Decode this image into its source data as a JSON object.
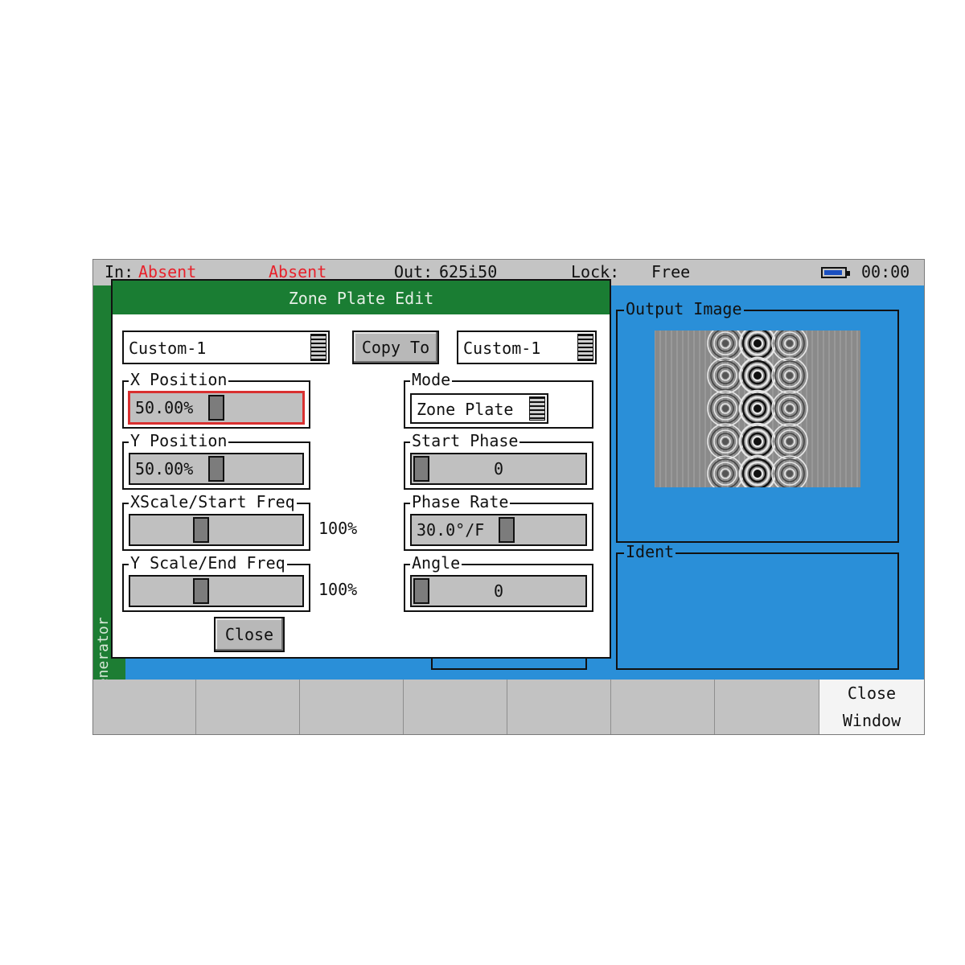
{
  "status_bar": {
    "in_label": "In:",
    "in_value": "Absent",
    "second_value": "Absent",
    "out_label": "Out:",
    "out_value": "625i50",
    "lock_label": "Lock:",
    "lock_value": "Free",
    "time": "00:00",
    "battery_icon": "battery-icon"
  },
  "sidebar": {
    "label": "Generator"
  },
  "panels": {
    "output_image": "Output Image",
    "ident": "Ident"
  },
  "softkeys": {
    "close_window_line1": "Close",
    "close_window_line2": "Window"
  },
  "dialog": {
    "title": "Zone Plate Edit",
    "source_preset": "Custom-1",
    "copy_to_label": "Copy To",
    "target_preset": "Custom-1",
    "close_label": "Close",
    "x_position": {
      "label": "X Position",
      "value": "50.00%",
      "fraction": 0.5
    },
    "y_position": {
      "label": "Y Position",
      "value": "50.00%",
      "fraction": 0.5
    },
    "x_scale": {
      "label": "XScale/Start Freq",
      "value": "100%",
      "fraction": 0.4
    },
    "y_scale": {
      "label": "Y Scale/End Freq",
      "value": "100%",
      "fraction": 0.4
    },
    "mode": {
      "label": "Mode",
      "value": "Zone Plate"
    },
    "start_phase": {
      "label": "Start Phase",
      "value": "0",
      "fraction": 0.0
    },
    "phase_rate": {
      "label": "Phase Rate",
      "value": "30.0°/F",
      "fraction": 0.55
    },
    "angle": {
      "label": "Angle",
      "value": "0",
      "fraction": 0.0
    }
  },
  "colors": {
    "screen_bg": "#2a8fd8",
    "title_green": "#1a7d33",
    "alert_red": "#e8202a",
    "focus_red": "#d93030"
  }
}
